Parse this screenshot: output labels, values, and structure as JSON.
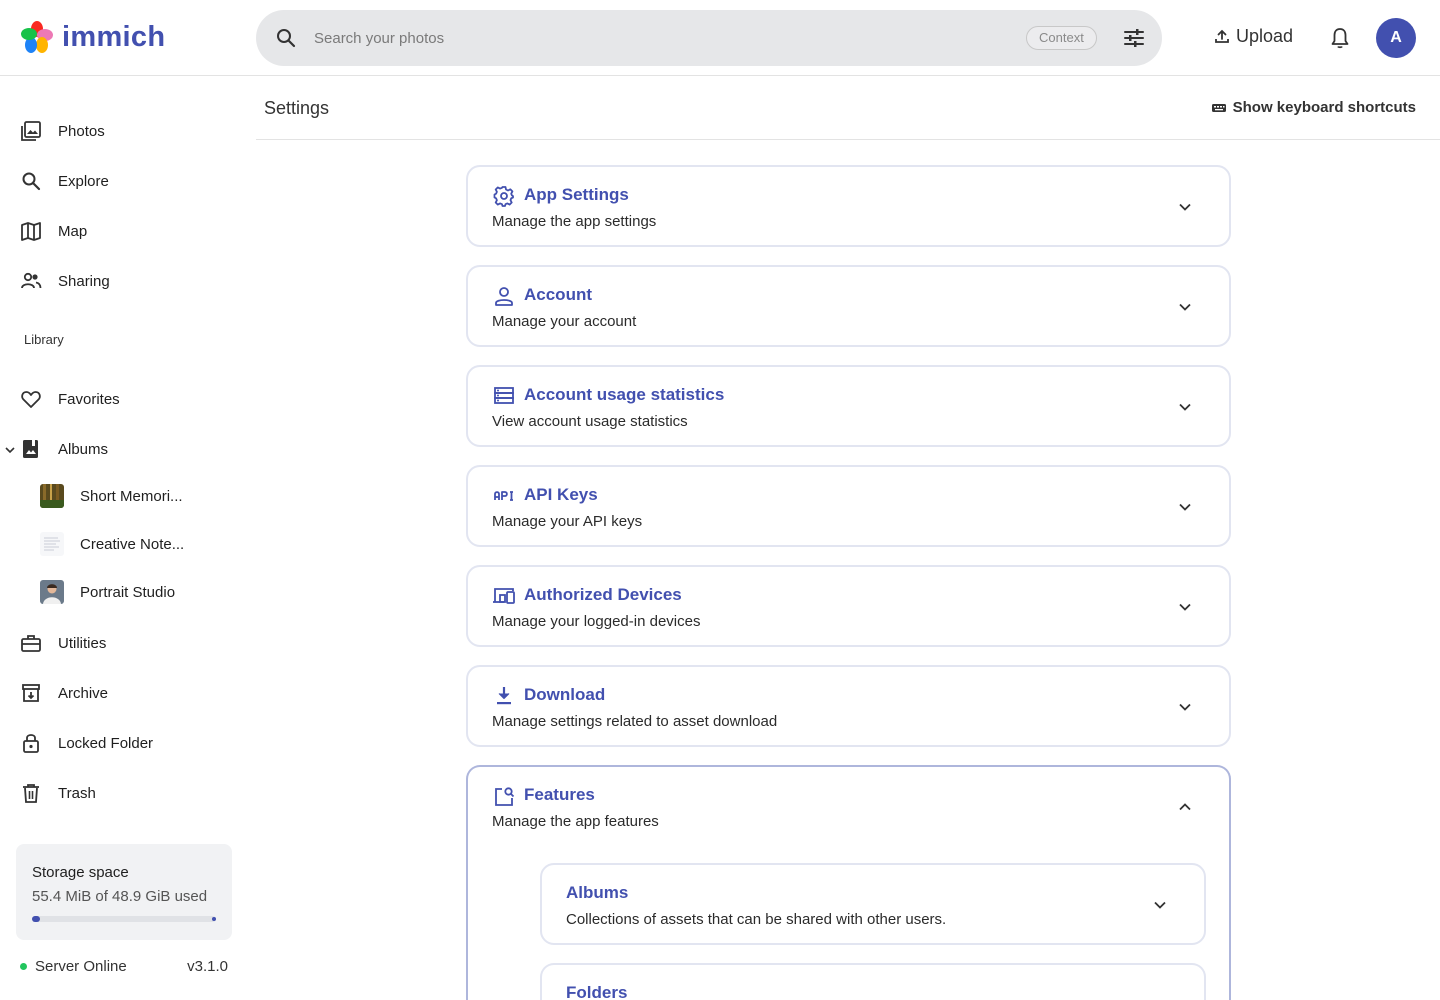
{
  "app": {
    "name": "immich",
    "search_placeholder": "Search your photos",
    "context_label": "Context",
    "upload_label": "Upload",
    "avatar_initial": "A"
  },
  "sidebar": {
    "nav": [
      {
        "label": "Photos",
        "icon": "photos-icon"
      },
      {
        "label": "Explore",
        "icon": "search-icon"
      },
      {
        "label": "Map",
        "icon": "map-icon"
      },
      {
        "label": "Sharing",
        "icon": "people-icon"
      }
    ],
    "library_label": "Library",
    "library": [
      {
        "label": "Favorites",
        "icon": "heart-icon"
      },
      {
        "label": "Albums",
        "icon": "album-icon"
      }
    ],
    "albums": [
      {
        "label": "Short Memori..."
      },
      {
        "label": "Creative Note..."
      },
      {
        "label": "Portrait Studio"
      }
    ],
    "more": [
      {
        "label": "Utilities",
        "icon": "toolbox-icon"
      },
      {
        "label": "Archive",
        "icon": "archive-icon"
      },
      {
        "label": "Locked Folder",
        "icon": "lock-icon"
      },
      {
        "label": "Trash",
        "icon": "trash-icon"
      }
    ],
    "storage": {
      "title": "Storage space",
      "usage": "55.4 MiB of 48.9 GiB used",
      "fraction": 0.0011
    },
    "server": {
      "status": "Server Online",
      "version": "v3.1.0"
    }
  },
  "settings": {
    "title": "Settings",
    "shortcuts_label": "Show keyboard shortcuts",
    "sections": [
      {
        "title": "App Settings",
        "desc": "Manage the app settings",
        "icon": "gear-icon"
      },
      {
        "title": "Account",
        "desc": "Manage your account",
        "icon": "user-icon"
      },
      {
        "title": "Account usage statistics",
        "desc": "View account usage statistics",
        "icon": "server-icon"
      },
      {
        "title": "API Keys",
        "desc": "Manage your API keys",
        "icon": "api-icon"
      },
      {
        "title": "Authorized Devices",
        "desc": "Manage your logged-in devices",
        "icon": "devices-icon"
      },
      {
        "title": "Download",
        "desc": "Manage settings related to asset download",
        "icon": "download-icon"
      },
      {
        "title": "Features",
        "desc": "Manage the app features",
        "icon": "features-icon"
      }
    ],
    "features_sub": [
      {
        "title": "Albums",
        "desc": "Collections of assets that can be shared with other users."
      },
      {
        "title": "Folders"
      }
    ]
  }
}
